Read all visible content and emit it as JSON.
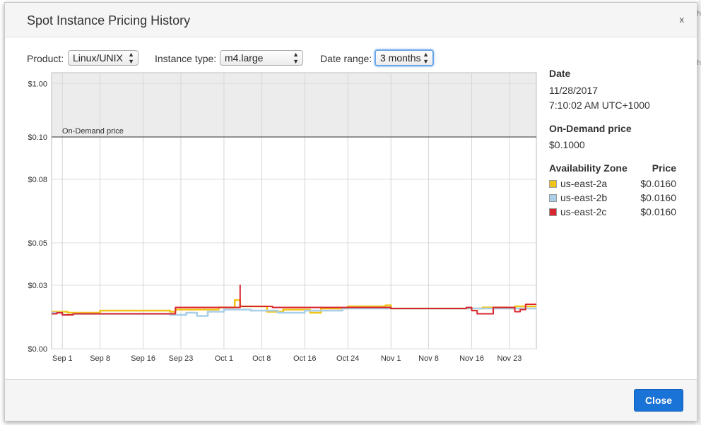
{
  "background": {
    "fragments": [
      "h",
      "h"
    ]
  },
  "modal": {
    "title": "Spot Instance Pricing History",
    "close_glyph": "x",
    "close_button": "Close"
  },
  "controls": {
    "product_label": "Product:",
    "product_value": "Linux/UNIX",
    "instance_label": "Instance type:",
    "instance_value": "m4.large",
    "range_label": "Date range:",
    "range_value": "3 months"
  },
  "details": {
    "date_label": "Date",
    "date_line1": "11/28/2017",
    "date_line2": "7:10:02 AM UTC+1000",
    "od_label": "On-Demand price",
    "od_value": "$0.1000",
    "az_header": "Availability Zone",
    "price_header": "Price",
    "zones": [
      {
        "name": "us-east-2a",
        "price": "$0.0160",
        "color": "#f0c419"
      },
      {
        "name": "us-east-2b",
        "price": "$0.0160",
        "color": "#a9cfe9"
      },
      {
        "name": "us-east-2c",
        "price": "$0.0160",
        "color": "#d9262e"
      }
    ]
  },
  "chart_data": {
    "type": "line",
    "x_start": "2017-08-30",
    "x_end": "2017-11-28",
    "x_ticks": [
      {
        "date": "2017-09-01",
        "label": "Sep 1"
      },
      {
        "date": "2017-09-08",
        "label": "Sep 8"
      },
      {
        "date": "2017-09-16",
        "label": "Sep 16"
      },
      {
        "date": "2017-09-23",
        "label": "Sep 23"
      },
      {
        "date": "2017-10-01",
        "label": "Oct 1"
      },
      {
        "date": "2017-10-08",
        "label": "Oct 8"
      },
      {
        "date": "2017-10-16",
        "label": "Oct 16"
      },
      {
        "date": "2017-10-24",
        "label": "Oct 24"
      },
      {
        "date": "2017-11-01",
        "label": "Nov 1"
      },
      {
        "date": "2017-11-08",
        "label": "Nov 8"
      },
      {
        "date": "2017-11-16",
        "label": "Nov 16"
      },
      {
        "date": "2017-11-23",
        "label": "Nov 23"
      }
    ],
    "y_ticks": [
      {
        "value": 0.0,
        "label": "$0.00"
      },
      {
        "value": 0.03,
        "label": "$0.03"
      },
      {
        "value": 0.05,
        "label": "$0.05"
      },
      {
        "value": 0.08,
        "label": "$0.08"
      },
      {
        "value": 0.1,
        "label": "$0.10"
      },
      {
        "value": 1.0,
        "label": "$1.00"
      }
    ],
    "ondemand_label": "On-Demand price",
    "ondemand_price": 0.1,
    "grid": true,
    "series": [
      {
        "name": "us-east-2a",
        "color": "#f0c419",
        "points": [
          [
            "2017-08-30",
            0.0175
          ],
          [
            "2017-09-02",
            0.017
          ],
          [
            "2017-09-08",
            0.018
          ],
          [
            "2017-09-21",
            0.0175
          ],
          [
            "2017-09-22",
            0.0185
          ],
          [
            "2017-09-30",
            0.0195
          ],
          [
            "2017-10-03",
            0.023
          ],
          [
            "2017-10-04",
            0.02
          ],
          [
            "2017-10-09",
            0.0175
          ],
          [
            "2017-10-12",
            0.0185
          ],
          [
            "2017-10-17",
            0.017
          ],
          [
            "2017-10-19",
            0.019
          ],
          [
            "2017-10-24",
            0.02
          ],
          [
            "2017-10-31",
            0.0205
          ],
          [
            "2017-11-01",
            0.019
          ],
          [
            "2017-11-17",
            0.019
          ],
          [
            "2017-11-18",
            0.0195
          ],
          [
            "2017-11-23",
            0.019
          ],
          [
            "2017-11-24",
            0.02
          ],
          [
            "2017-11-28",
            0.02
          ]
        ]
      },
      {
        "name": "us-east-2b",
        "color": "#a9cfe9",
        "points": [
          [
            "2017-08-30",
            0.017
          ],
          [
            "2017-09-01",
            0.016
          ],
          [
            "2017-09-03",
            0.0165
          ],
          [
            "2017-09-21",
            0.016
          ],
          [
            "2017-09-24",
            0.017
          ],
          [
            "2017-09-26",
            0.0155
          ],
          [
            "2017-09-28",
            0.0175
          ],
          [
            "2017-10-01",
            0.0185
          ],
          [
            "2017-10-06",
            0.018
          ],
          [
            "2017-10-11",
            0.017
          ],
          [
            "2017-10-16",
            0.018
          ],
          [
            "2017-10-23",
            0.019
          ],
          [
            "2017-11-28",
            0.019
          ]
        ]
      },
      {
        "name": "us-east-2c",
        "color": "#d9262e",
        "points": [
          [
            "2017-08-30",
            0.0165
          ],
          [
            "2017-08-31",
            0.017
          ],
          [
            "2017-09-01",
            0.016
          ],
          [
            "2017-09-03",
            0.0165
          ],
          [
            "2017-09-21",
            0.0165
          ],
          [
            "2017-09-22",
            0.0195
          ],
          [
            "2017-10-03",
            0.0195
          ],
          [
            "2017-10-04",
            0.03
          ],
          [
            "2017-10-04",
            0.02
          ],
          [
            "2017-10-08",
            0.02
          ],
          [
            "2017-10-10",
            0.0195
          ],
          [
            "2017-10-24",
            0.0195
          ],
          [
            "2017-11-01",
            0.019
          ],
          [
            "2017-11-15",
            0.0195
          ],
          [
            "2017-11-16",
            0.018
          ],
          [
            "2017-11-17",
            0.0165
          ],
          [
            "2017-11-20",
            0.0195
          ],
          [
            "2017-11-24",
            0.0175
          ],
          [
            "2017-11-25",
            0.0185
          ],
          [
            "2017-11-26",
            0.021
          ],
          [
            "2017-11-28",
            0.021
          ]
        ]
      }
    ]
  }
}
